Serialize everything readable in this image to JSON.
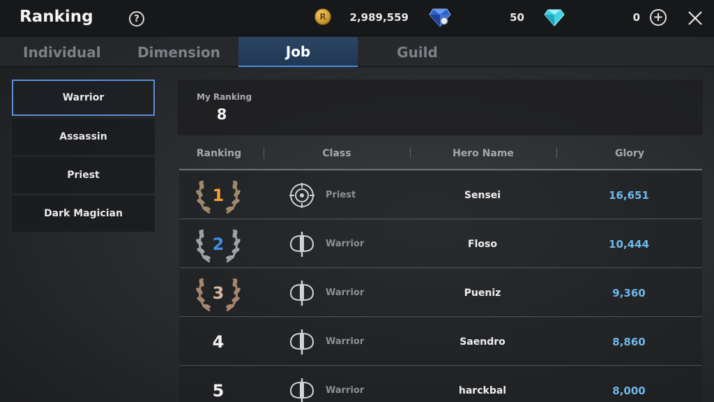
{
  "header": {
    "title": "Ranking",
    "help_icon": "?",
    "gold": {
      "icon": "gold-coin-icon",
      "glyph": "R",
      "value": "2,989,559"
    },
    "gem": {
      "icon": "blue-gem-icon",
      "value": "50"
    },
    "diamond": {
      "icon": "cyan-diamond-icon",
      "value": "0"
    },
    "plus_glyph": "+"
  },
  "tabs": [
    {
      "label": "Individual",
      "active": false
    },
    {
      "label": "Dimension",
      "active": false
    },
    {
      "label": "Job",
      "active": true
    },
    {
      "label": "Guild",
      "active": false
    }
  ],
  "jobs": [
    {
      "label": "Warrior",
      "selected": true
    },
    {
      "label": "Assassin",
      "selected": false
    },
    {
      "label": "Priest",
      "selected": false
    },
    {
      "label": "Dark Magician",
      "selected": false
    }
  ],
  "my_ranking": {
    "label": "My Ranking",
    "value": "8"
  },
  "table": {
    "columns": [
      "Ranking",
      "Class",
      "Hero Name",
      "Glory"
    ],
    "rows": [
      {
        "rank": "1",
        "class": "Priest",
        "hero": "Sensei",
        "glory": "16,651"
      },
      {
        "rank": "2",
        "class": "Warrior",
        "hero": "Floso",
        "glory": "10,444"
      },
      {
        "rank": "3",
        "class": "Warrior",
        "hero": "Pueniz",
        "glory": "9,360"
      },
      {
        "rank": "4",
        "class": "Warrior",
        "hero": "Saendro",
        "glory": "8,860"
      },
      {
        "rank": "5",
        "class": "Warrior",
        "hero": "harckbal",
        "glory": "8,000"
      }
    ]
  },
  "colors": {
    "accent": "#4a8be0",
    "glory": "#6fb8ea",
    "rank1": "#f2a33a",
    "rank2": "#3f8ee6",
    "rank3": "#d8b8a0",
    "laurel_gold": "#a08a6e",
    "laurel_silver": "#9ea3a8",
    "laurel_bronze": "#a88670"
  }
}
